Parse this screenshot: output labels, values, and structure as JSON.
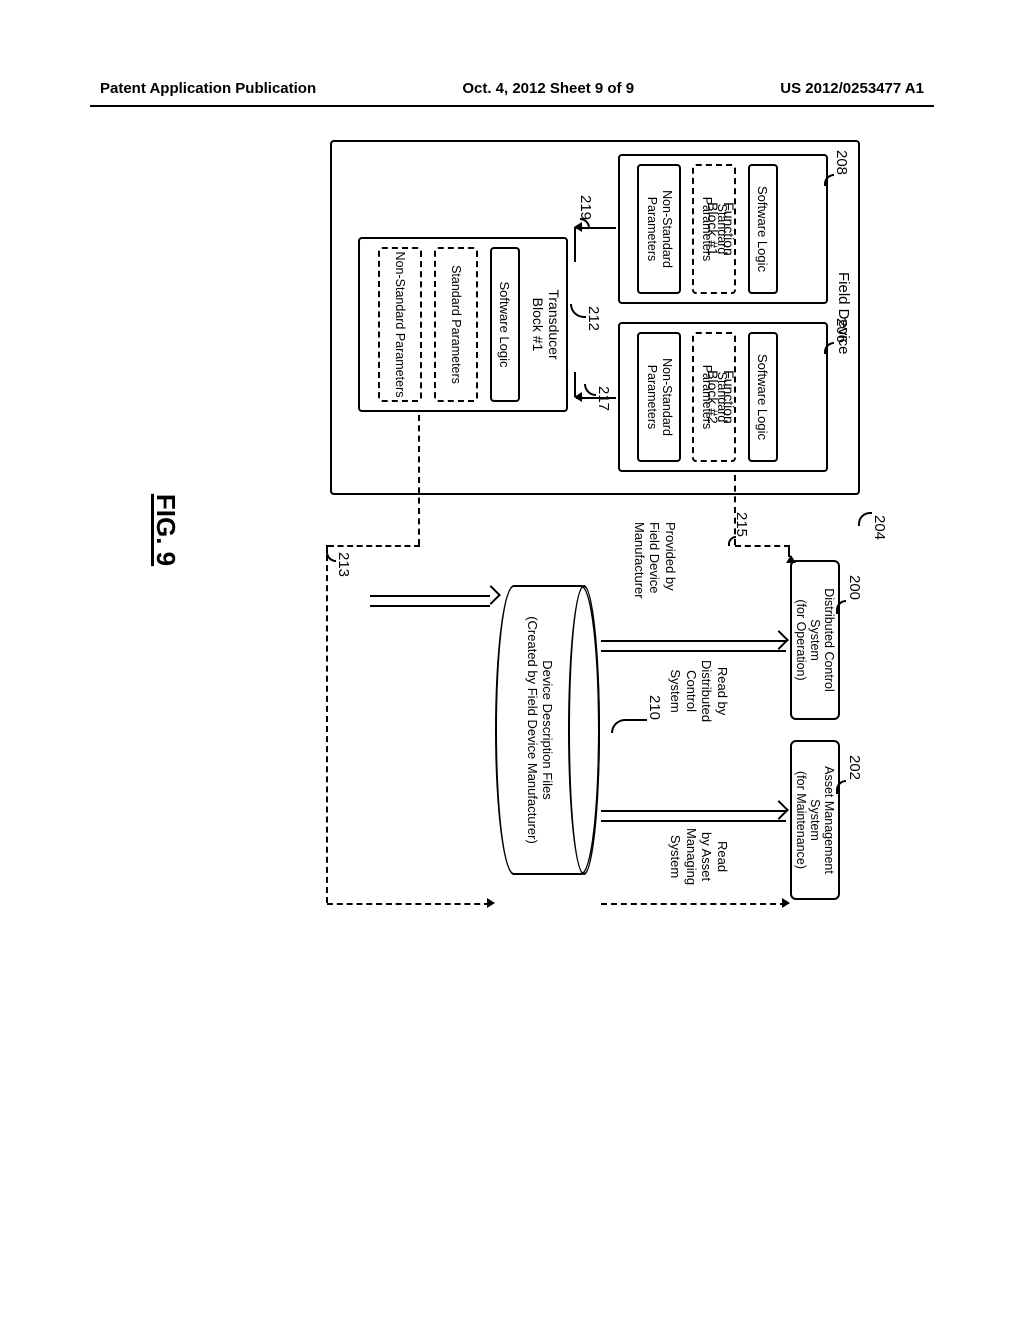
{
  "header": {
    "left": "Patent Application Publication",
    "center": "Oct. 4, 2012  Sheet 9 of 9",
    "right": "US 2012/0253477 A1"
  },
  "figure_label": "FIG. 9",
  "refs": {
    "r200": "200",
    "r202": "202",
    "r204": "204",
    "r206": "206",
    "r208": "208",
    "r210": "210",
    "r212": "212",
    "r213": "213",
    "r215": "215",
    "r217": "217",
    "r219": "219"
  },
  "labels": {
    "field_device": "Field Device",
    "function_block_1": "Function\nBlock #1",
    "function_block_2": "Function\nBlock #2",
    "transducer_block_1": "Transducer\nBlock #1",
    "software_logic": "Software Logic",
    "standard_params": "Standard\nParameters",
    "nonstandard_params": "Non-Standard\nParameters",
    "dcs": "Distributed Control System\n(for Operation)",
    "ams": "Asset Management System\n(for Maintenance)",
    "dd_files": "Device Description Files\n(Created by Field Device Manufacturer)",
    "read_by_dcs": "Read by\nDistributed\nControl\nSystem",
    "read_by_ams": "Read\nby Asset\nManaging\nSystem",
    "provided_by": "Provided by\nField Device\nManufacturer"
  }
}
